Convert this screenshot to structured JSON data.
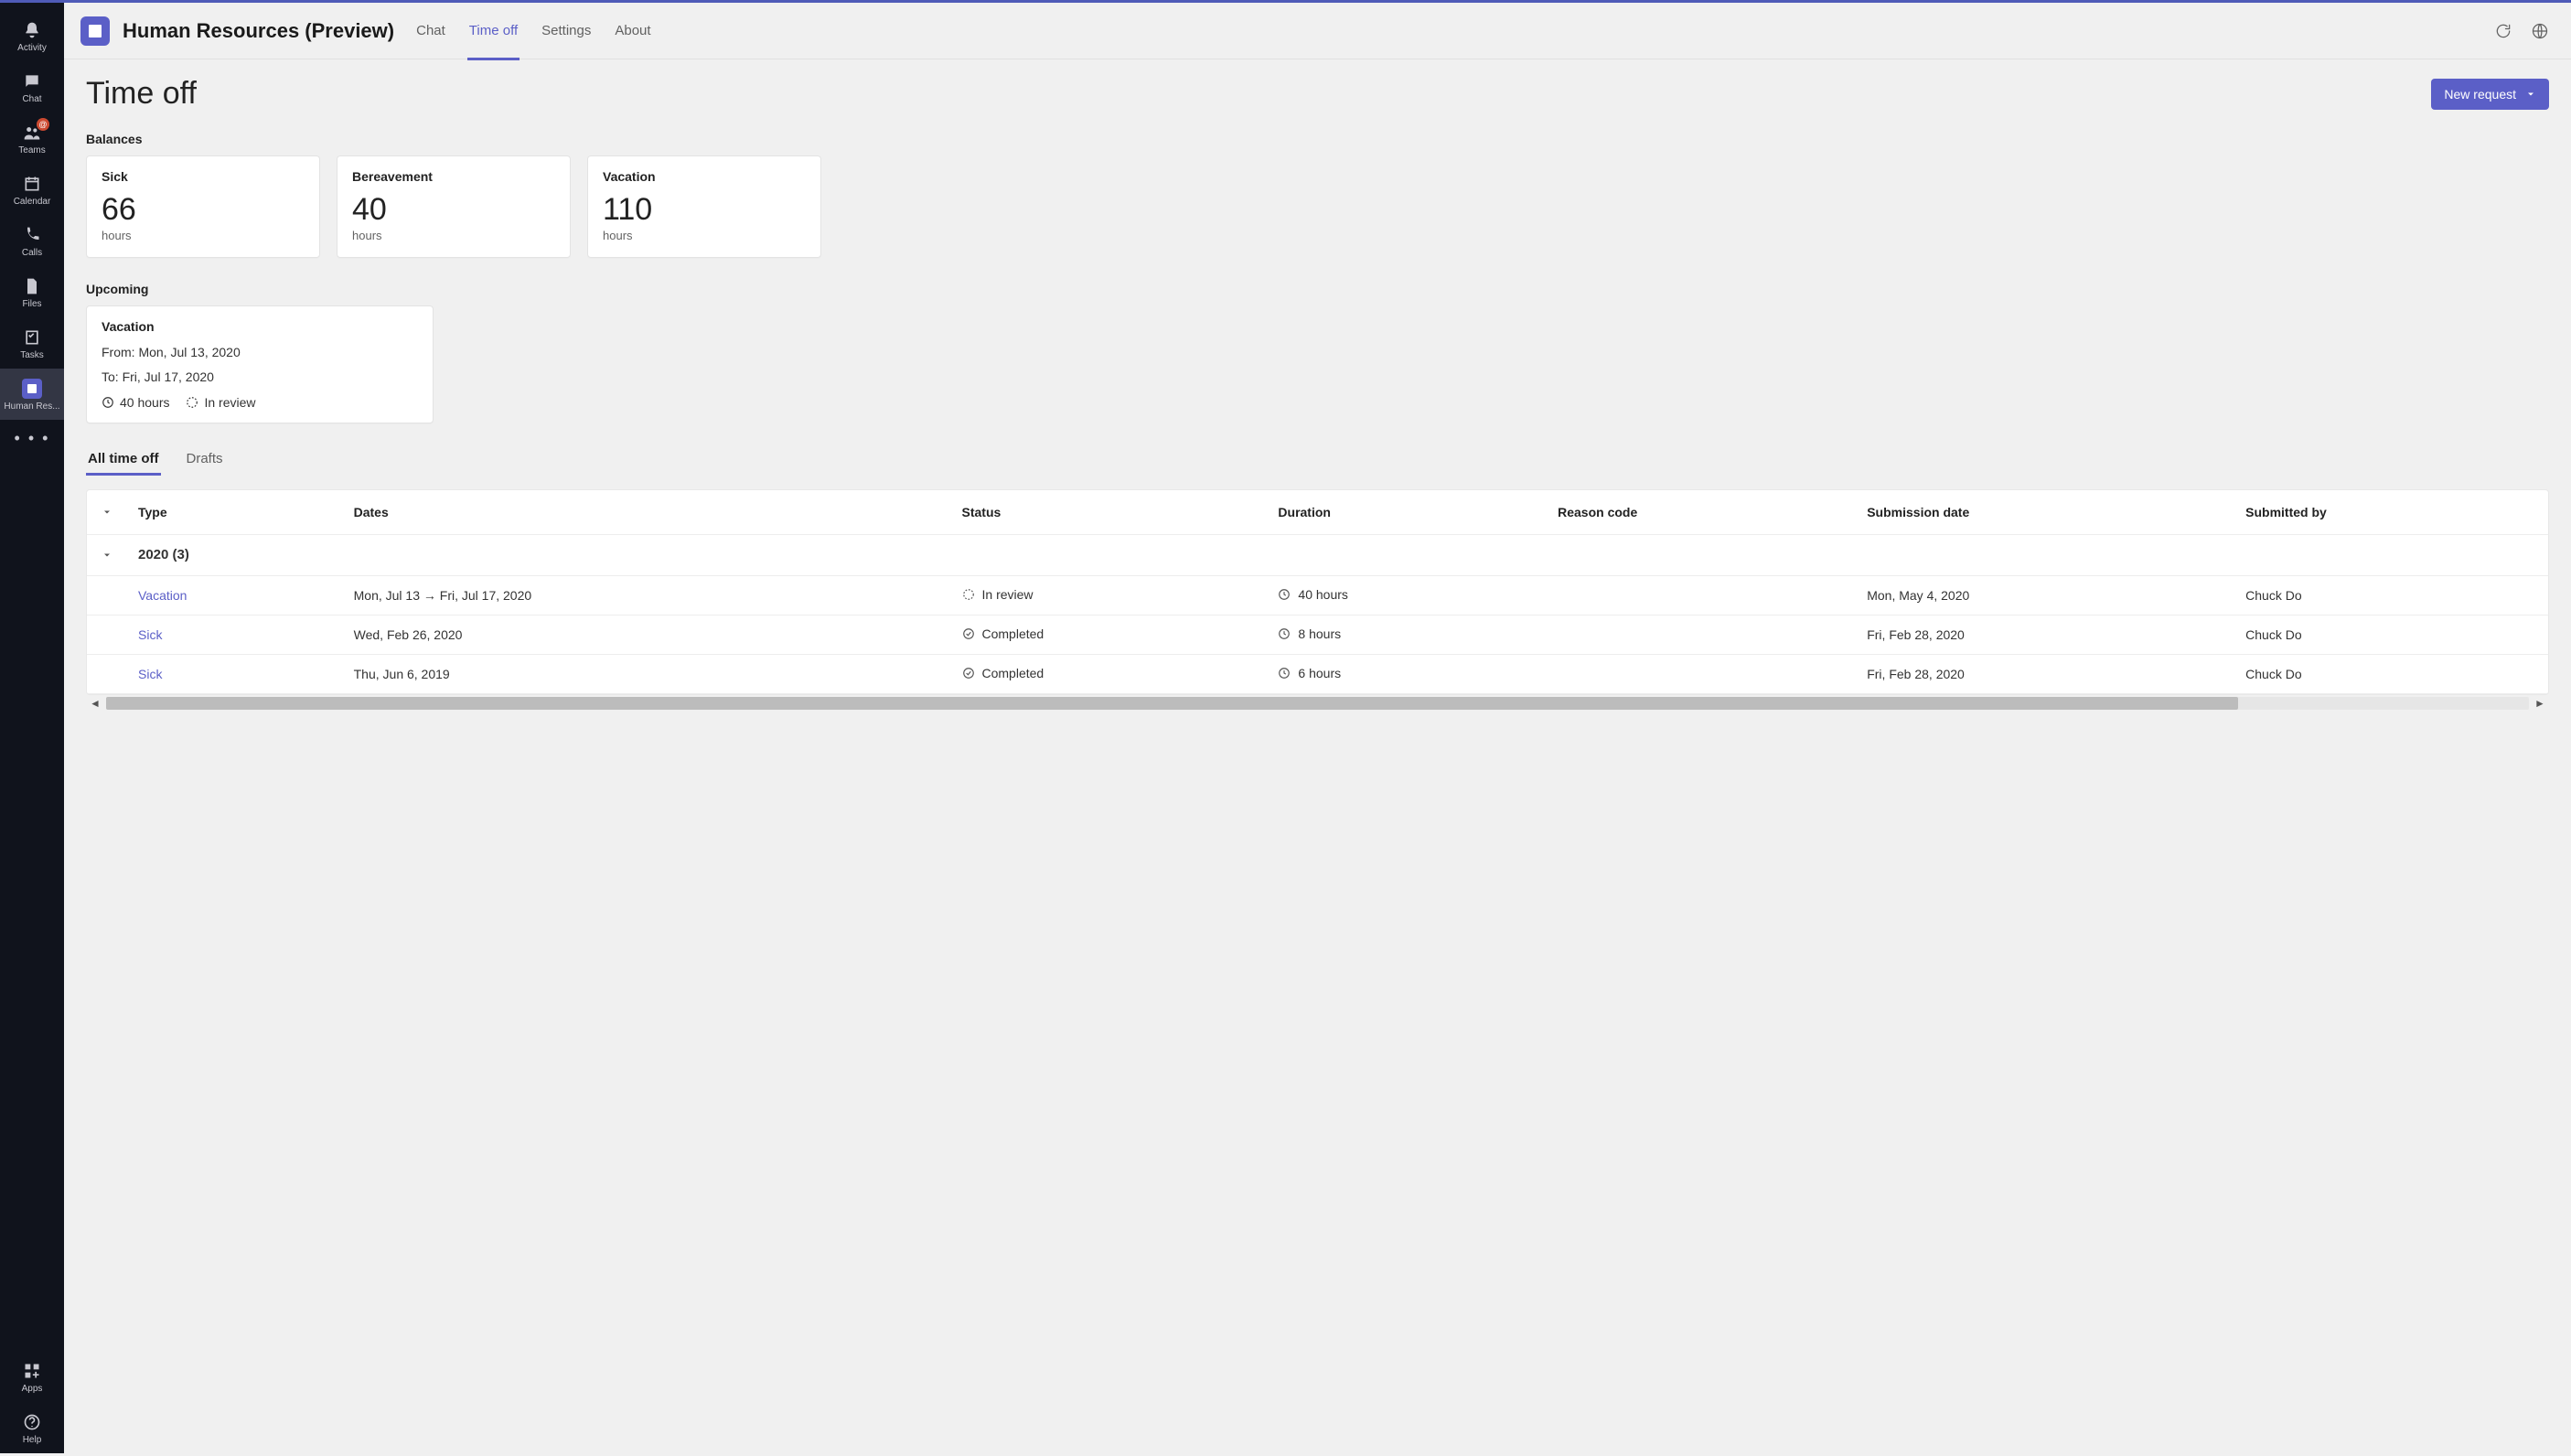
{
  "rail": {
    "items": [
      {
        "label": "Activity",
        "name": "activity"
      },
      {
        "label": "Chat",
        "name": "chat"
      },
      {
        "label": "Teams",
        "name": "teams",
        "badge": "@"
      },
      {
        "label": "Calendar",
        "name": "calendar"
      },
      {
        "label": "Calls",
        "name": "calls"
      },
      {
        "label": "Files",
        "name": "files"
      },
      {
        "label": "Tasks",
        "name": "tasks"
      },
      {
        "label": "Human Res...",
        "name": "human-resources",
        "selected": true
      }
    ],
    "apps_label": "Apps",
    "help_label": "Help"
  },
  "header": {
    "title": "Human Resources (Preview)",
    "tabs": [
      {
        "label": "Chat",
        "active": false
      },
      {
        "label": "Time off",
        "active": true
      },
      {
        "label": "Settings",
        "active": false
      },
      {
        "label": "About",
        "active": false
      }
    ]
  },
  "page": {
    "title": "Time off",
    "new_request_label": "New request"
  },
  "balances": {
    "section_label": "Balances",
    "cards": [
      {
        "title": "Sick",
        "value": "66",
        "unit": "hours"
      },
      {
        "title": "Bereavement",
        "value": "40",
        "unit": "hours"
      },
      {
        "title": "Vacation",
        "value": "110",
        "unit": "hours"
      }
    ]
  },
  "upcoming": {
    "section_label": "Upcoming",
    "card": {
      "title": "Vacation",
      "from_label": "From: Mon, Jul 13, 2020",
      "to_label": "To: Fri, Jul 17, 2020",
      "duration": "40 hours",
      "status": "In review"
    }
  },
  "list_tabs": [
    {
      "label": "All time off",
      "active": true
    },
    {
      "label": "Drafts",
      "active": false
    }
  ],
  "table": {
    "columns": [
      "Type",
      "Dates",
      "Status",
      "Duration",
      "Reason code",
      "Submission date",
      "Submitted by"
    ],
    "group": "2020 (3)",
    "rows": [
      {
        "type": "Vacation",
        "dates": "Mon, Jul 13 → Fri, Jul 17, 2020",
        "status": "In review",
        "status_icon": "pending",
        "duration": "40 hours",
        "reason": "",
        "submission": "Mon, May 4, 2020",
        "submitted": "Chuck Do"
      },
      {
        "type": "Sick",
        "dates": "Wed, Feb 26, 2020",
        "status": "Completed",
        "status_icon": "completed",
        "duration": "8 hours",
        "reason": "",
        "submission": "Fri, Feb 28, 2020",
        "submitted": "Chuck Do"
      },
      {
        "type": "Sick",
        "dates": "Thu, Jun 6, 2019",
        "status": "Completed",
        "status_icon": "completed",
        "duration": "6 hours",
        "reason": "",
        "submission": "Fri, Feb 28, 2020",
        "submitted": "Chuck Do"
      }
    ]
  }
}
